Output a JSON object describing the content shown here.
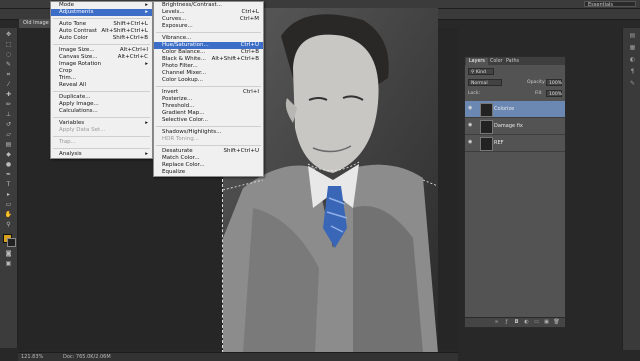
{
  "app": {
    "doc_tab": "Old Image",
    "workspace": "Essentials"
  },
  "image_menu": {
    "items": [
      {
        "label": "Mode",
        "shortcut": "",
        "disabled": false,
        "submenu": true
      },
      {
        "label": "Adjustments",
        "shortcut": "",
        "disabled": false,
        "submenu": true,
        "active": true
      },
      {
        "sep": true
      },
      {
        "label": "Auto Tone",
        "shortcut": "Shift+Ctrl+L",
        "disabled": false
      },
      {
        "label": "Auto Contrast",
        "shortcut": "Alt+Shift+Ctrl+L",
        "disabled": false
      },
      {
        "label": "Auto Color",
        "shortcut": "Shift+Ctrl+B",
        "disabled": false
      },
      {
        "sep": true
      },
      {
        "label": "Image Size...",
        "shortcut": "Alt+Ctrl+I",
        "disabled": false
      },
      {
        "label": "Canvas Size...",
        "shortcut": "Alt+Ctrl+C",
        "disabled": false
      },
      {
        "label": "Image Rotation",
        "shortcut": "",
        "disabled": false,
        "submenu": true
      },
      {
        "label": "Crop",
        "shortcut": "",
        "disabled": false
      },
      {
        "label": "Trim...",
        "shortcut": "",
        "disabled": false
      },
      {
        "label": "Reveal All",
        "shortcut": "",
        "disabled": false
      },
      {
        "sep": true
      },
      {
        "label": "Duplicate...",
        "shortcut": "",
        "disabled": false
      },
      {
        "label": "Apply Image...",
        "shortcut": "",
        "disabled": false
      },
      {
        "label": "Calculations...",
        "shortcut": "",
        "disabled": false
      },
      {
        "sep": true
      },
      {
        "label": "Variables",
        "shortcut": "",
        "disabled": false,
        "submenu": true
      },
      {
        "label": "Apply Data Set...",
        "shortcut": "",
        "disabled": true
      },
      {
        "sep": true
      },
      {
        "label": "Trap...",
        "shortcut": "",
        "disabled": true
      },
      {
        "sep": true
      },
      {
        "label": "Analysis",
        "shortcut": "",
        "disabled": false,
        "submenu": true
      }
    ]
  },
  "adjustments_menu": {
    "items": [
      {
        "label": "Brightness/Contrast...",
        "shortcut": ""
      },
      {
        "label": "Levels...",
        "shortcut": "Ctrl+L"
      },
      {
        "label": "Curves...",
        "shortcut": "Ctrl+M"
      },
      {
        "label": "Exposure...",
        "shortcut": ""
      },
      {
        "sep": true
      },
      {
        "label": "Vibrance...",
        "shortcut": ""
      },
      {
        "label": "Hue/Saturation...",
        "shortcut": "Ctrl+U",
        "highlighted": true
      },
      {
        "label": "Color Balance...",
        "shortcut": "Ctrl+B"
      },
      {
        "label": "Black & White...",
        "shortcut": "Alt+Shift+Ctrl+B"
      },
      {
        "label": "Photo Filter...",
        "shortcut": ""
      },
      {
        "label": "Channel Mixer...",
        "shortcut": ""
      },
      {
        "label": "Color Lookup...",
        "shortcut": ""
      },
      {
        "sep": true
      },
      {
        "label": "Invert",
        "shortcut": "Ctrl+I"
      },
      {
        "label": "Posterize...",
        "shortcut": ""
      },
      {
        "label": "Threshold...",
        "shortcut": ""
      },
      {
        "label": "Gradient Map...",
        "shortcut": ""
      },
      {
        "label": "Selective Color...",
        "shortcut": ""
      },
      {
        "sep": true
      },
      {
        "label": "Shadows/Highlights...",
        "shortcut": ""
      },
      {
        "label": "HDR Toning...",
        "shortcut": "",
        "disabled": true
      },
      {
        "sep": true
      },
      {
        "label": "Desaturate",
        "shortcut": "Shift+Ctrl+U"
      },
      {
        "label": "Match Color...",
        "shortcut": ""
      },
      {
        "label": "Replace Color...",
        "shortcut": ""
      },
      {
        "label": "Equalize",
        "shortcut": ""
      }
    ]
  },
  "layers_panel": {
    "tabs": [
      "Layers",
      "Color",
      "Paths"
    ],
    "kind_label": "Kind",
    "blend_mode": "Normal",
    "opacity_label": "Opacity:",
    "opacity_value": "100%",
    "lock_label": "Lock:",
    "fill_label": "Fill:",
    "fill_value": "100%",
    "layers": [
      {
        "name": "Colorize",
        "selected": true
      },
      {
        "name": "Damage fix",
        "selected": false
      },
      {
        "name": "REF",
        "selected": false
      }
    ]
  },
  "status": {
    "zoom": "121.83%",
    "doc": "Doc: 765.0K/2.06M"
  },
  "colors": {
    "highlight": "#3c6ec8",
    "selected_layer": "#6b88b2",
    "tie": "#3a66b8"
  }
}
